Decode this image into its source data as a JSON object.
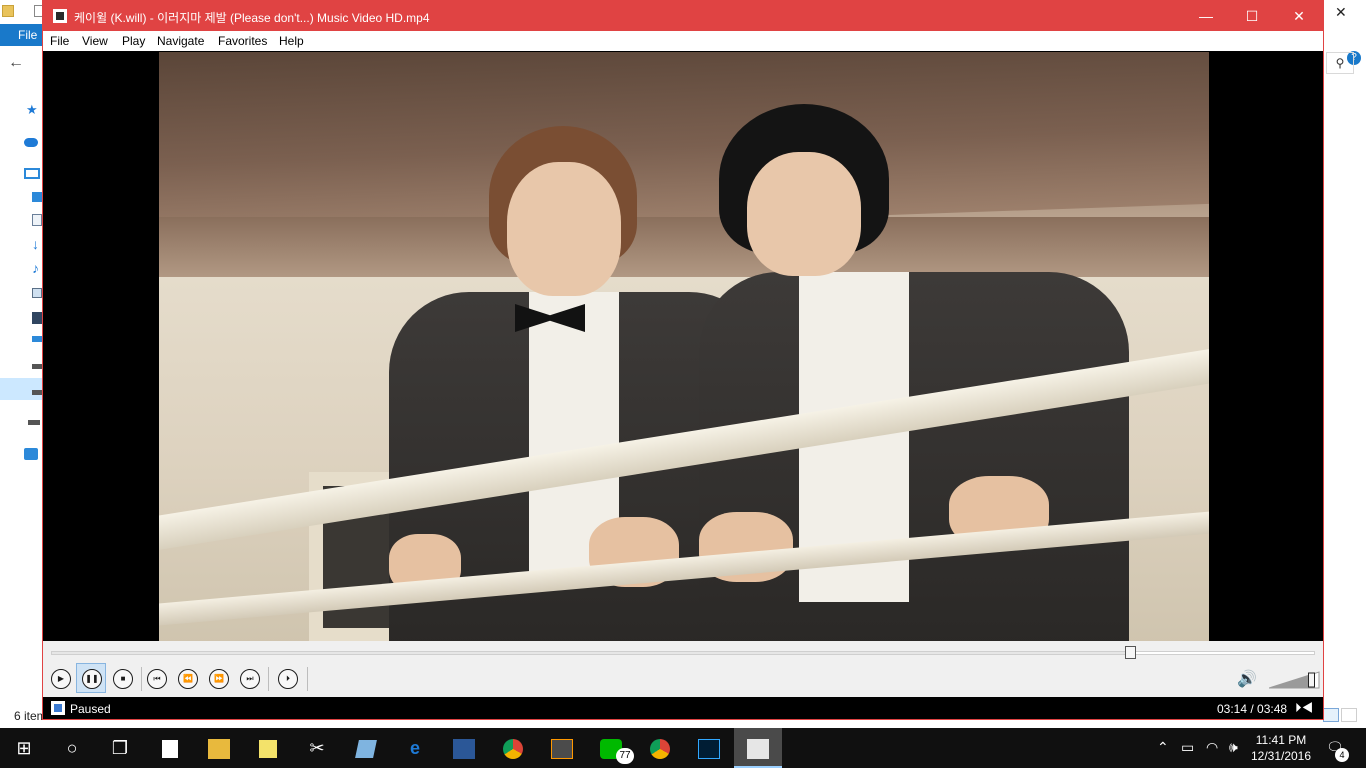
{
  "explorer": {
    "file_tab": "File",
    "status_text": "6 item",
    "help": "?"
  },
  "player": {
    "title": "케이윌 (K.will) - 이러지마 제발 (Please don't...) Music Video HD.mp4",
    "menu": [
      "File",
      "View",
      "Play",
      "Navigate",
      "Favorites",
      "Help"
    ],
    "seek_progress": 0.854,
    "status": "Paused",
    "time": "03:14 / 03:48",
    "volume_level": 0.85,
    "controls": [
      "play-icon",
      "pause-icon",
      "stop-icon",
      "previous-icon",
      "rewind-icon",
      "fast-forward-icon",
      "next-icon",
      "frame-step-icon"
    ],
    "colors": {
      "titlebar": "#e04343",
      "statusbar": "#000000",
      "volume": "#7a9c3a"
    }
  },
  "taskbar": {
    "apps": [
      "start",
      "cortana",
      "task-view",
      "store",
      "file-explorer",
      "sticky-notes",
      "snipping-tool",
      "notes",
      "edge",
      "word",
      "chrome",
      "sublime-text",
      "line",
      "chrome-2",
      "photoshop",
      "media-player-classic"
    ],
    "line_badge": "77",
    "clock_time": "11:41 PM",
    "clock_date": "12/31/2016",
    "notification_count": "4"
  }
}
